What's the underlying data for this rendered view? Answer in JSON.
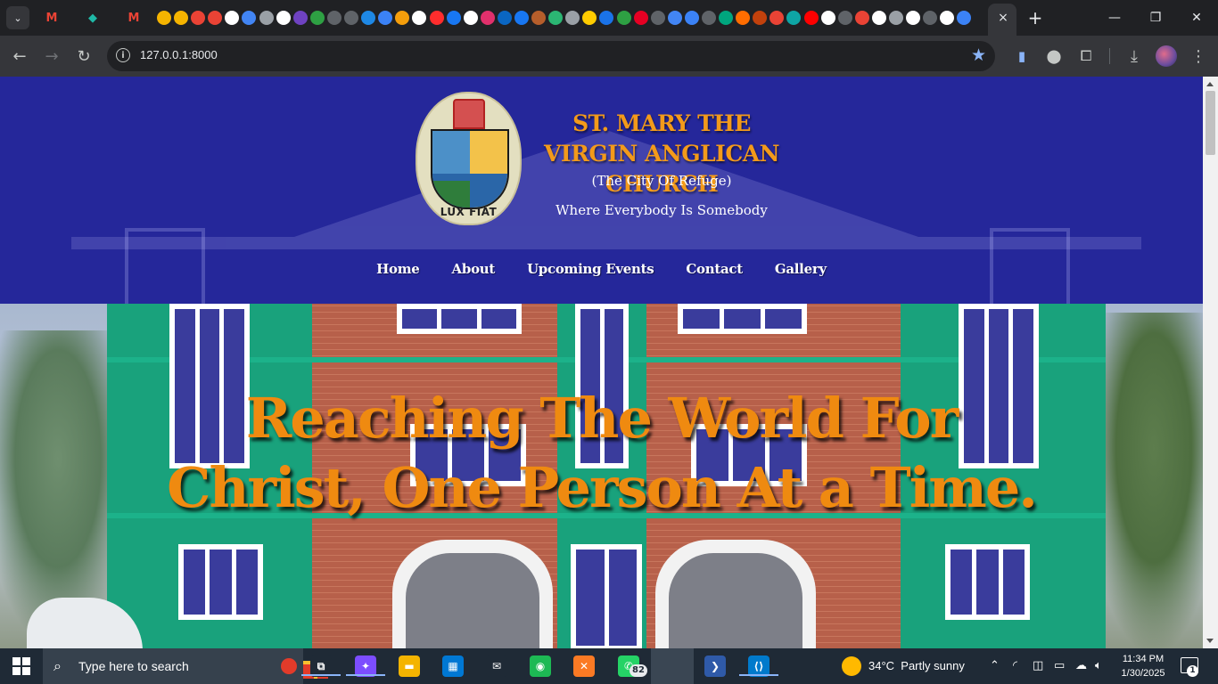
{
  "browser": {
    "tabs_search_icon": "chevron-down-icon",
    "pinned_tabs": [
      {
        "label": "M",
        "color": "#ea4335"
      },
      {
        "label": "◆",
        "color": "#1fb8a6"
      },
      {
        "label": "M",
        "color": "#ea4335"
      }
    ],
    "tab_favicons": [
      "#f5b400",
      "#f5b400",
      "#ea4335",
      "#ea4335",
      "#ffffff",
      "#4285f4",
      "#9aa0a6",
      "#ffffff",
      "#6f42c1",
      "#2ea043",
      "#5f6368",
      "#5f6368",
      "#1e88e5",
      "#3b82f6",
      "#f59e0b",
      "#ffffff",
      "#ff2d2d",
      "#1877f2",
      "#ffffff",
      "#e1306c",
      "#0a66c2",
      "#1877f2",
      "#b65e2b",
      "#2bb673",
      "#9aa0a6",
      "#ffcc00",
      "#1a73e8",
      "#2ea043",
      "#e60023",
      "#5f6368",
      "#4285f4",
      "#3b82f6",
      "#5f6368",
      "#00a67e",
      "#ff6d00",
      "#c2410c",
      "#ea4335",
      "#0ea5a5",
      "#ff0000",
      "#ffffff",
      "#5f6368",
      "#ea4335",
      "#ffffff",
      "#9aa0a6",
      "#ffffff",
      "#5f6368",
      "#ffffff",
      "#3b82f6"
    ],
    "active_tab_close": "×",
    "new_tab": "+",
    "window_controls": {
      "minimize": "—",
      "restore": "❐",
      "close": "✕"
    },
    "url": "127.0.0.1:8000",
    "bookmark_color": "#8ab4f8"
  },
  "site": {
    "church_name": "ST. MARY THE VIRGIN ANGLICAN CHURCH",
    "subtitle": "(The City Of Refuge)",
    "tagline": "Where Everybody Is Somebody",
    "logo_text": "LUX FIAT",
    "nav": [
      "Home",
      "About",
      "Upcoming Events",
      "Contact",
      "Gallery"
    ],
    "hero_line1": "Reaching The World For",
    "hero_line2": "Christ, One Person At a Time.",
    "colors": {
      "header_bg": "#25279a",
      "accent": "#ef8a10",
      "building_green": "#19a27c"
    }
  },
  "taskbar": {
    "search_placeholder": "Type here to search",
    "apps": [
      {
        "name": "task-view",
        "glyph": "⧉",
        "color": "#1f2a36"
      },
      {
        "name": "copilot",
        "glyph": "✦",
        "color": "#7c4dff"
      },
      {
        "name": "file-explorer",
        "glyph": "▬",
        "color": "#f4b400"
      },
      {
        "name": "microsoft-store",
        "glyph": "▦",
        "color": "#0078d4"
      },
      {
        "name": "mail",
        "glyph": "✉",
        "color": "#1f2a36"
      },
      {
        "name": "spotify",
        "glyph": "◉",
        "color": "#1db954"
      },
      {
        "name": "xampp",
        "glyph": "✕",
        "color": "#fb7a24"
      },
      {
        "name": "whatsapp",
        "glyph": "✆",
        "color": "#25d366"
      },
      {
        "name": "chrome",
        "glyph": "◎",
        "color": "#4285f4"
      },
      {
        "name": "powershell",
        "glyph": "❯",
        "color": "#2f5aa8"
      },
      {
        "name": "vscode",
        "glyph": "⟨⟩",
        "color": "#007acc"
      }
    ],
    "whatsapp_badge": "82",
    "weather_temp": "34°C",
    "weather_desc": "Partly sunny",
    "weather_alert": "1",
    "time": "11:34 PM",
    "date": "1/30/2025",
    "notifications": "1"
  }
}
